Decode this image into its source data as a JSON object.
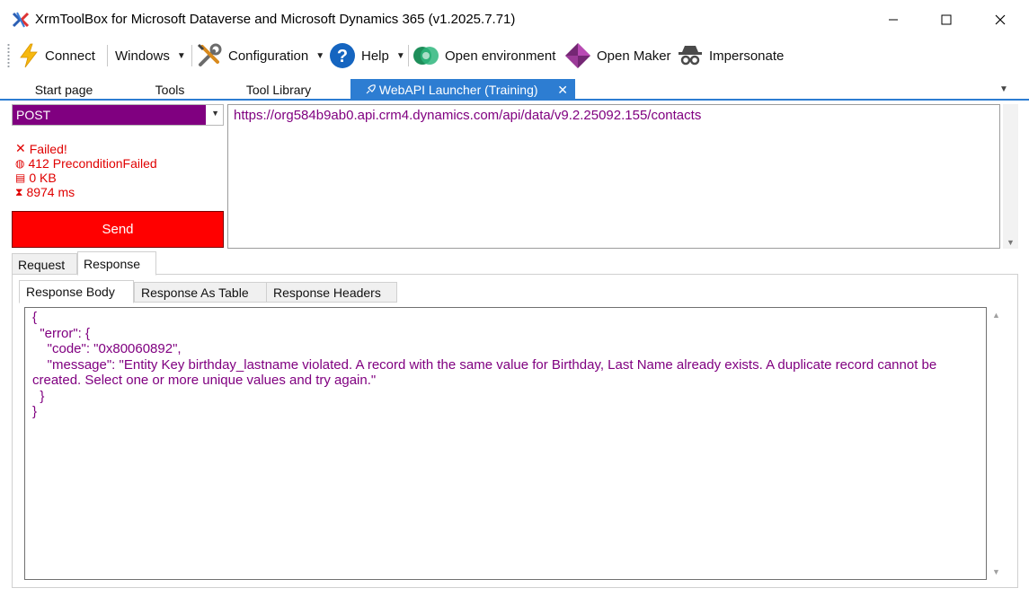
{
  "window": {
    "title": "XrmToolBox for Microsoft Dataverse and Microsoft Dynamics 365 (v1.2025.7.71)",
    "minimize_glyph": "—",
    "maximize_glyph": "☐",
    "close_glyph": "✕"
  },
  "toolbar": {
    "connect": "Connect",
    "windows": "Windows",
    "configuration": "Configuration",
    "help": "Help",
    "open_environment": "Open environment",
    "open_maker": "Open Maker",
    "impersonate": "Impersonate",
    "icons": {
      "connect": "lightning-icon",
      "configuration": "wrench-screwdriver-icon",
      "help": "question-circle-icon",
      "open_environment": "dataverse-icon",
      "open_maker": "power-apps-icon",
      "impersonate": "spy-icon"
    }
  },
  "tabs": {
    "items": [
      "Start page",
      "Tools",
      "Tool Library",
      "WebAPI Launcher (Training)"
    ],
    "active_index": 3,
    "close_glyph": "✕",
    "overflow_glyph": "▼"
  },
  "request": {
    "method": "POST",
    "url": "https://org584b9ab0.api.crm4.dynamics.com/api/data/v9.2.25092.155/contacts",
    "send_label": "Send"
  },
  "status": {
    "result": "Failed!",
    "code": "412 PreconditionFailed",
    "size": "0 KB",
    "duration": "8974 ms",
    "result_icon": "✕",
    "code_icon": "◍",
    "size_icon": "▤",
    "duration_icon": "⧗"
  },
  "subtabs": {
    "items": [
      "Request",
      "Response"
    ],
    "active_index": 1
  },
  "response_tabs": {
    "items": [
      "Response Body",
      "Response As Table",
      "Response Headers"
    ],
    "active_index": 0
  },
  "response_body": "{\n  \"error\": {\n    \"code\": \"0x80060892\",\n    \"message\": \"Entity Key birthday_lastname violated. A record with the same value for Birthday, Last Name already exists. A duplicate record cannot be created. Select one or more unique values and try again.\"\n  }\n}",
  "colors": {
    "method_bg": "#800080",
    "send_bg": "#ff0000",
    "error_text": "#e00000",
    "active_tab": "#2d7dd2"
  }
}
